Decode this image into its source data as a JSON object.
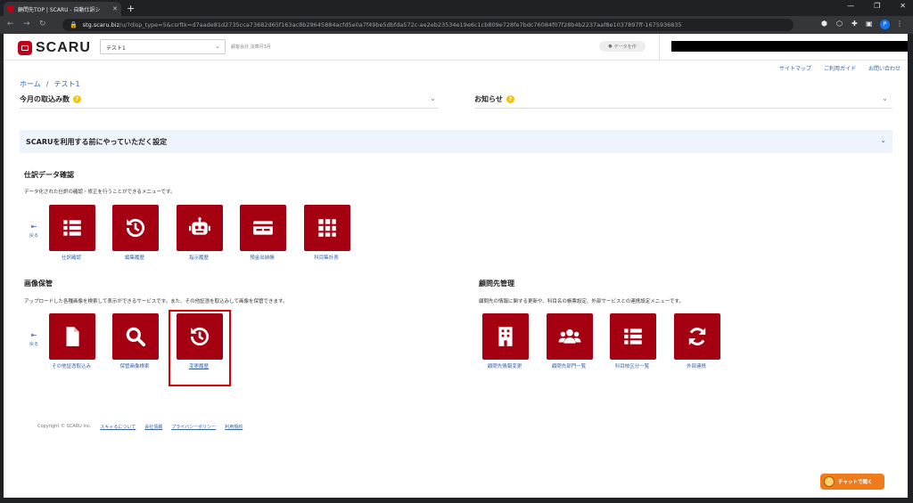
{
  "browser": {
    "tab_title": "顧問先TOP | SCARU - 自動仕訳シ",
    "url_host": "stg.scaru.biz",
    "url_path": "/u/?disp_type=5&csrftk=d7aade81d2735cca73682d65f163ac8b29645884acfd5e0a7f49be5dbfda572c-ae2eb23534e19e6c1cb809e728fe7bdc76084f07f28b4b2237aaf8e1037897ff-1675936835",
    "new_tab": "+",
    "profile_initial": "P"
  },
  "header": {
    "logo_text": "SCARU",
    "client_select": "テスト1",
    "fiscal_note": "顧客会計 決算月3月",
    "data_button": "データを作"
  },
  "util_links": [
    "サイトマップ",
    "ご利用ガイド",
    "お問い合わせ"
  ],
  "breadcrumb": {
    "home": "ホーム",
    "sep": "/",
    "current": "テスト1"
  },
  "sections": {
    "monthly": "今月の取込み数",
    "news": "お知らせ",
    "settings": "SCARUを利用する前にやっていただく設定",
    "help_mark": "?"
  },
  "journal": {
    "title": "仕訳データ確認",
    "desc": "データ化された仕訳の確認・修正を行うことができるメニューです。",
    "back": "戻る",
    "tiles": [
      {
        "label": "仕訳確認",
        "icon": "list-icon"
      },
      {
        "label": "編集履歴",
        "icon": "history-icon"
      },
      {
        "label": "指示履歴",
        "icon": "robot-icon"
      },
      {
        "label": "預金出納帳",
        "icon": "passbook-icon"
      },
      {
        "label": "科目集計表",
        "icon": "grid-icon"
      }
    ]
  },
  "image_storage": {
    "title": "画像保管",
    "desc": "アップロードした各種画像を検索して表示ができるサービスです。また、その他証憑を取込みして画像を保管できます。",
    "back": "戻る",
    "tiles": [
      {
        "label": "その他証憑取込み",
        "icon": "document-icon"
      },
      {
        "label": "保管画像検索",
        "icon": "search-icon"
      },
      {
        "label": "変更履歴",
        "icon": "history-icon"
      }
    ]
  },
  "client_mgmt": {
    "title": "顧問先管理",
    "desc": "顧問先の情報に関する更新や、科目名の帳票設定、外部サービスとの連携設定メニューです。",
    "tiles": [
      {
        "label": "顧問先情報変更",
        "icon": "building-icon"
      },
      {
        "label": "顧問先部門一覧",
        "icon": "users-icon"
      },
      {
        "label": "科目枝区分一覧",
        "icon": "list-icon"
      },
      {
        "label": "外部連携",
        "icon": "sync-icon"
      }
    ]
  },
  "footer": {
    "copyright": "Copyright © SCARU Inc.",
    "links": [
      "スキャるについて",
      "会社情報",
      "プライバシーポリシー",
      "利用規約"
    ]
  },
  "chat_button": "チャットで聞く",
  "colors": {
    "brand": "#a50011",
    "link": "#3763a8",
    "highlight": "#d90000"
  }
}
